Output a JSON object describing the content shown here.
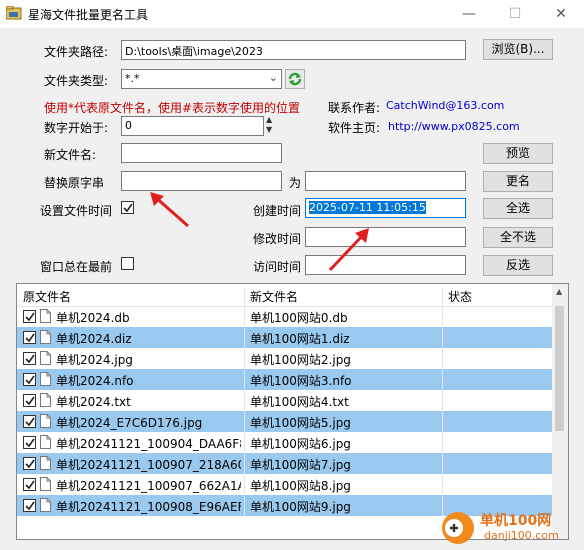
{
  "window": {
    "title": "星海文件批量更名工具",
    "minimize": "—",
    "maximize": "☐",
    "close": "✕"
  },
  "form": {
    "folder_path_label": "文件夹路径:",
    "folder_path_value": "D:\\tools\\桌面\\image\\2023",
    "browse_button": "浏览(B)...",
    "folder_type_label": "文件夹类型:",
    "folder_type_value": "*.*",
    "hint": "使用*代表原文件名，使用#表示数字使用的位置",
    "start_number_label": "数字开始于:",
    "start_number_value": "0",
    "contact_label": "联系作者:",
    "contact_value": "CatchWind@163.com",
    "homepage_label": "软件主页:",
    "homepage_value": "http://www.px0825.com",
    "new_name_label": "新文件名:",
    "new_name_value": "",
    "preview_button": "预览",
    "replace_label": "替换原字串",
    "replace_value": "",
    "to_label": "为",
    "to_value": "",
    "rename_button": "更名",
    "set_time_label": "设置文件时间",
    "set_time_checked": true,
    "created_label": "创建时间",
    "created_value": "2025-07-11 11:05:15",
    "select_all_button": "全选",
    "modified_label": "修改时间",
    "modified_value": "",
    "deselect_all_button": "全不选",
    "always_on_top_label": "窗口总在最前",
    "always_on_top_checked": false,
    "accessed_label": "访问时间",
    "accessed_value": "",
    "invert_button": "反选"
  },
  "list": {
    "columns": [
      "原文件名",
      "新文件名",
      "状态"
    ],
    "rows": [
      {
        "original": "单机2024.db",
        "new": "单机100网站0.db",
        "status": "",
        "selected": false
      },
      {
        "original": "单机2024.diz",
        "new": "单机100网站1.diz",
        "status": "",
        "selected": true
      },
      {
        "original": "单机2024.jpg",
        "new": "单机100网站2.jpg",
        "status": "",
        "selected": false
      },
      {
        "original": "单机2024.nfo",
        "new": "单机100网站3.nfo",
        "status": "",
        "selected": true
      },
      {
        "original": "单机2024.txt",
        "new": "单机100网站4.txt",
        "status": "",
        "selected": false
      },
      {
        "original": "单机2024_E7C6D176.jpg",
        "new": "单机100网站5.jpg",
        "status": "",
        "selected": true
      },
      {
        "original": "单机20241121_100904_DAA6F8...",
        "new": "单机100网站6.jpg",
        "status": "",
        "selected": false
      },
      {
        "original": "单机20241121_100907_218A60...",
        "new": "单机100网站7.jpg",
        "status": "",
        "selected": true
      },
      {
        "original": "单机20241121_100907_662A1A...",
        "new": "单机100网站8.jpg",
        "status": "",
        "selected": false
      },
      {
        "original": "单机20241121_100908_E96AEF...",
        "new": "单机100网站9.jpg",
        "status": "",
        "selected": true
      }
    ]
  },
  "watermark": {
    "name": "单机100网",
    "url": "danji100.com"
  },
  "colors": {
    "selection": "#99c9ef",
    "hint_red": "#c00000",
    "link_blue": "#0000cc",
    "arrow_red": "#e0201e"
  }
}
